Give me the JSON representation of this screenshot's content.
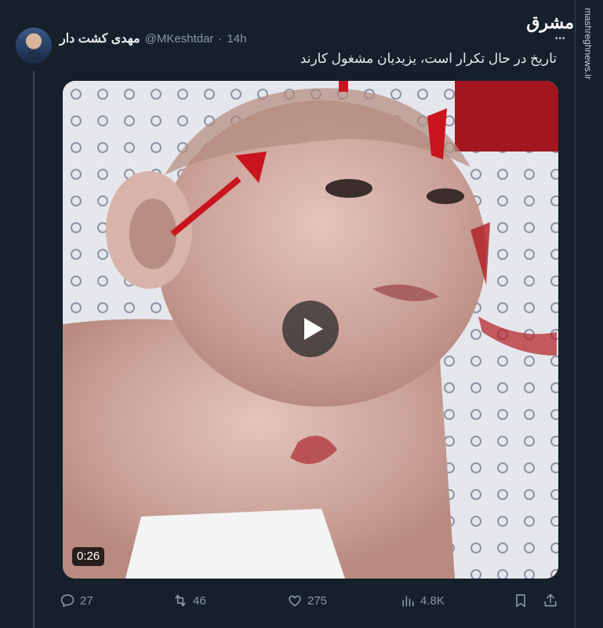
{
  "tweet": {
    "display_name": "مهدی کشت دار",
    "handle": "@MKeshtdar",
    "separator": "·",
    "time": "14h",
    "text": "تاریخ در حال تکرار است، یزیدیان مشغول کارند"
  },
  "watermark": {
    "logo_text": "مشرق",
    "dots": "•••",
    "url": "mashreghnews.ir"
  },
  "media": {
    "type": "video",
    "duration": "0:26"
  },
  "actions": {
    "reply_count": "27",
    "retweet_count": "46",
    "like_count": "275",
    "views_count": "4.8K"
  },
  "icons": {
    "reply": "reply-icon",
    "retweet": "retweet-icon",
    "like": "heart-icon",
    "views": "views-icon",
    "bookmark": "bookmark-icon",
    "share": "share-icon",
    "play": "play-icon"
  },
  "colors": {
    "background": "#15202b",
    "text": "#e7e9ea",
    "secondary": "#8b98a5"
  }
}
